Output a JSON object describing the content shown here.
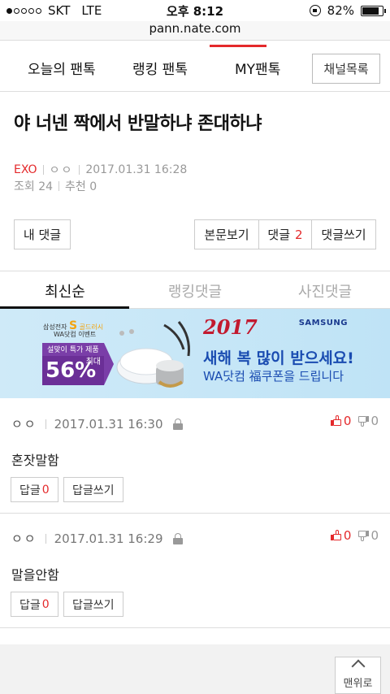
{
  "status": {
    "carrier": "SKT",
    "network": "LTE",
    "time": "오후 8:12",
    "battery": "82%",
    "battery_level": 0.82
  },
  "url": "pann.nate.com",
  "nav": {
    "items": [
      "오늘의 팬톡",
      "랭킹 팬톡",
      "MY팬톡"
    ],
    "channel_list": "채널목록"
  },
  "post": {
    "title": "야 너넨 짝에서 반말하냐 존대하냐",
    "channel": "EXO",
    "author": "ㅇㅇ",
    "date": "2017.01.31 16:28",
    "views_label": "조회 24",
    "recommend_label": "추천 0"
  },
  "actions": {
    "my_comments": "내 댓글",
    "view_post": "본문보기",
    "comments_label": "댓글",
    "comments_count": "2",
    "write_comment": "댓글쓰기"
  },
  "comment_tabs": [
    "최신순",
    "랭킹댓글",
    "사진댓글"
  ],
  "banner": {
    "small_brand": "삼성전자",
    "s_mark": "S",
    "store": "골드러시",
    "event": "WA닷컴 이벤트",
    "tag_line1": "설맞이 특가 제품",
    "tag_line2": "최대",
    "percent": "56%",
    "brand": "SAMSUNG",
    "year": "2017",
    "headline": "새해 복 많이 받으세요!",
    "sub": "WA닷컴 福쿠폰을 드립니다"
  },
  "comments": [
    {
      "author": "ㅇㅇ",
      "date": "2017.01.31 16:30",
      "up": "0",
      "down": "0",
      "text": "혼잣말함",
      "reply_label": "답글",
      "reply_count": "0",
      "write_reply": "답글쓰기"
    },
    {
      "author": "ㅇㅇ",
      "date": "2017.01.31 16:29",
      "up": "0",
      "down": "0",
      "text": "말을안함",
      "reply_label": "답글",
      "reply_count": "0",
      "write_reply": "답글쓰기"
    }
  ],
  "to_top": "맨위로",
  "colors": {
    "accent": "#e4292b",
    "banner_purple": "#6b2f97",
    "banner_blue": "#1a4cb1"
  }
}
